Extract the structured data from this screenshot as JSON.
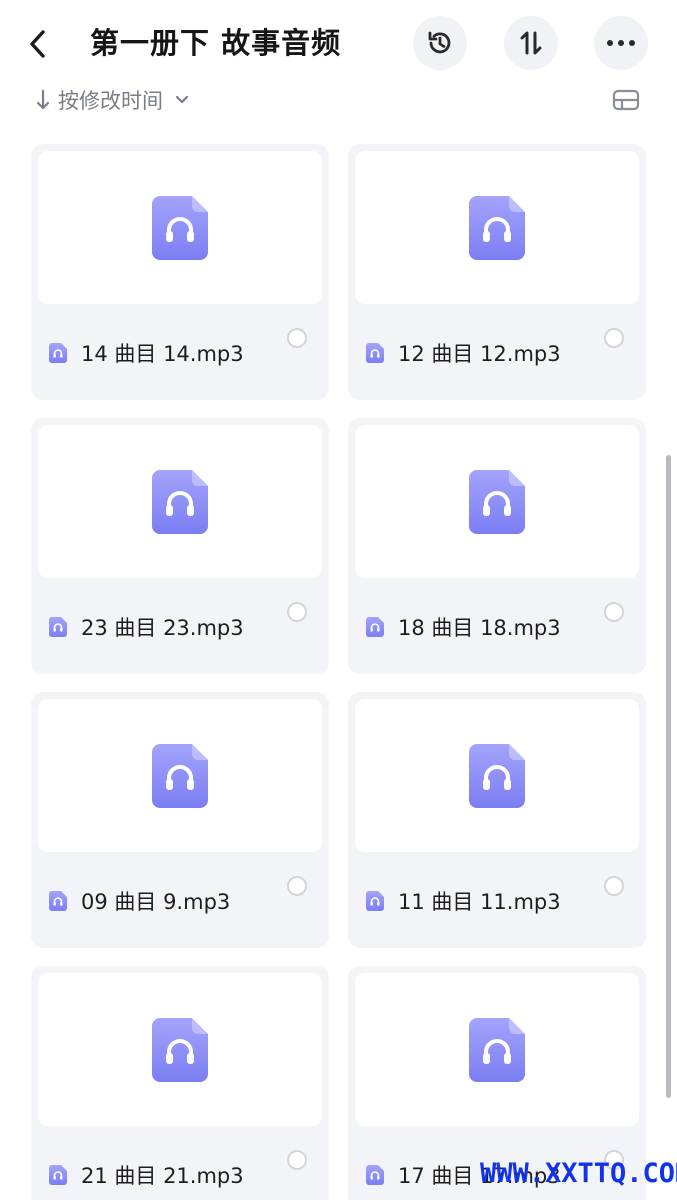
{
  "header": {
    "title": "第一册下 故事音频"
  },
  "sort": {
    "label": "按修改时间"
  },
  "colors": {
    "accent": "#8b8ef6",
    "card_bg": "#f3f4f7",
    "watermark": "#1234e8"
  },
  "files": [
    {
      "name": "14 曲目 14.mp3"
    },
    {
      "name": "12 曲目 12.mp3"
    },
    {
      "name": "23 曲目 23.mp3"
    },
    {
      "name": "18 曲目 18.mp3"
    },
    {
      "name": "09 曲目 9.mp3"
    },
    {
      "name": "11 曲目 11.mp3"
    },
    {
      "name": "21 曲目 21.mp3"
    },
    {
      "name": "17 曲目 17.mp3"
    }
  ],
  "watermark": "WWW.XXTTQ.COM"
}
